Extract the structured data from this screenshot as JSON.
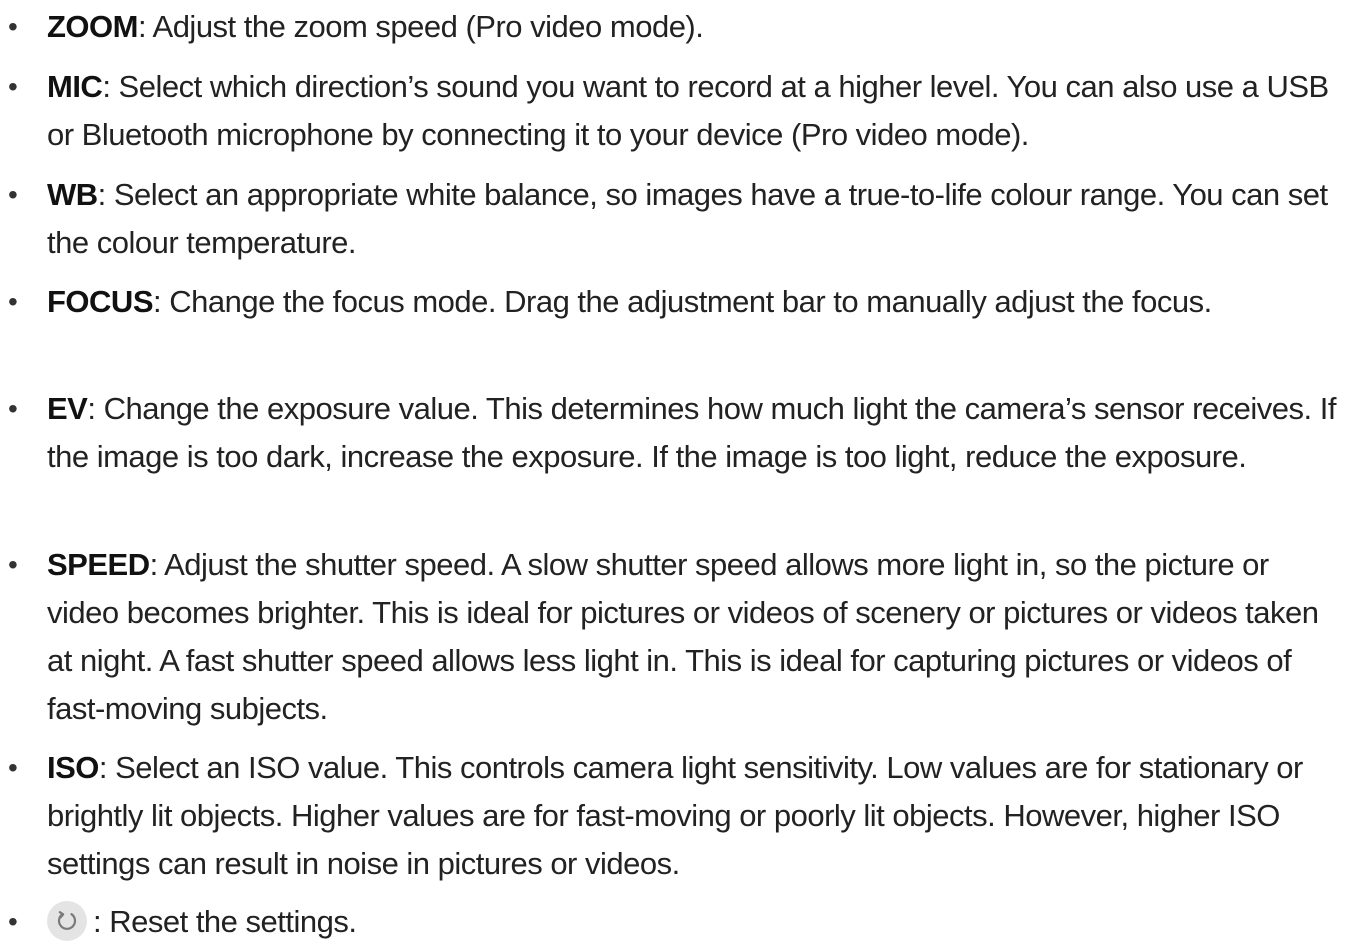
{
  "items": [
    {
      "term": "ZOOM",
      "desc": ": Adjust the zoom speed (Pro video mode)."
    },
    {
      "term": "MIC",
      "desc": ": Select which direction’s sound you want to record at a higher level. You can also use a USB or Bluetooth microphone by connecting it to your device (Pro video mode)."
    },
    {
      "term": "WB",
      "desc": ": Select an appropriate white balance, so images have a true-to-life colour range. You can set the colour temperature."
    },
    {
      "term": "FOCUS",
      "desc": ": Change the focus mode. Drag the adjustment bar to manually adjust the focus."
    },
    {
      "term": "EV",
      "desc": ": Change the exposure value. This determines how much light the camera’s sensor receives. If the image is too dark, increase the exposure. If the image is too light, reduce the exposure."
    },
    {
      "term": "SPEED",
      "desc": ": Adjust the shutter speed. A slow shutter speed allows more light in, so the picture or video becomes brighter. This is ideal for pictures or videos of scenery or pictures or videos taken at night. A fast shutter speed allows less light in. This is ideal for capturing pictures or videos of fast-moving subjects."
    },
    {
      "term": "ISO",
      "desc": ": Select an ISO value. This controls camera light sensitivity. Low values are for stationary or brightly lit objects. Higher values are for fast-moving or poorly lit objects. However, higher ISO settings can result in noise in pictures or videos."
    },
    {
      "icon": "reset-icon",
      "desc": ": Reset the settings."
    }
  ],
  "bullet": "•"
}
